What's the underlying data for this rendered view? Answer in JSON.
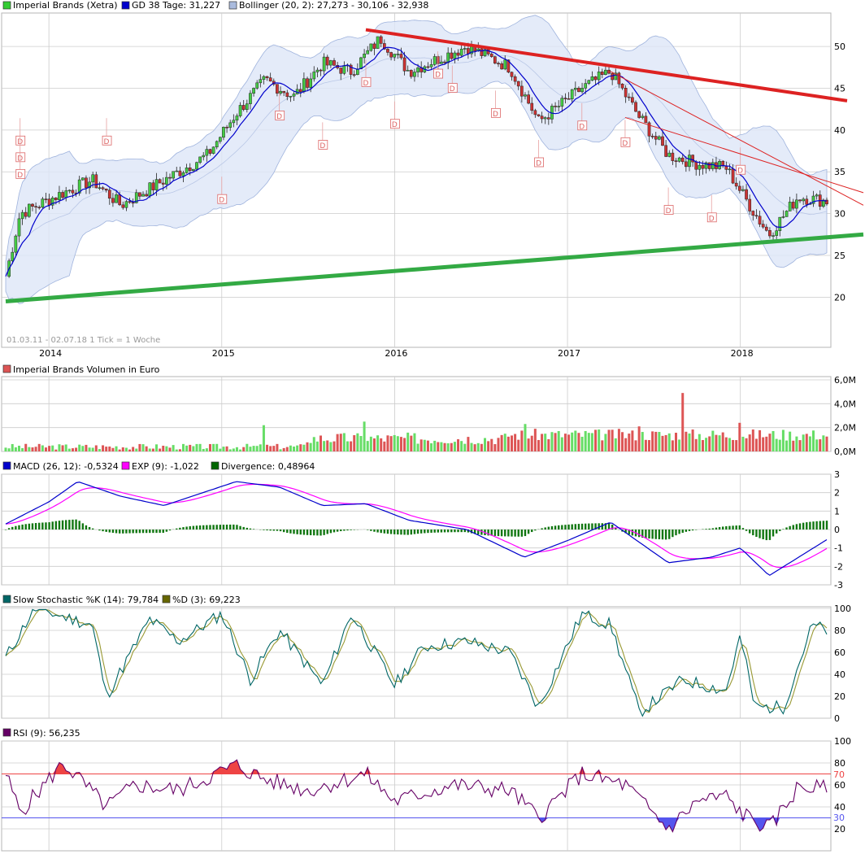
{
  "price_panel": {
    "legend": [
      {
        "label": "Imperial Brands (Xetra)",
        "color": "#33cc33"
      },
      {
        "label": "GD 38 Tage: 31,227",
        "color": "#0000cc"
      },
      {
        "label": "Bollinger (20, 2): 27,273 - 30,106 - 32,938",
        "color": "#aabbdd"
      }
    ],
    "info": "01.03.11 - 02.07.18   1 Tick = 1 Woche",
    "dividend_marker": "D",
    "x_labels": [
      "2014",
      "2015",
      "2016",
      "2017",
      "2018"
    ],
    "y_ticks": [
      20,
      25,
      30,
      35,
      40,
      45,
      50
    ]
  },
  "volume_panel": {
    "legend": [
      {
        "label": "Imperial Brands Volumen in Euro",
        "color": "#dd5555"
      }
    ],
    "y_ticks": [
      "0,0M",
      "2,0M",
      "4,0M",
      "6,0M"
    ]
  },
  "macd_panel": {
    "legend": [
      {
        "label": "MACD (26, 12): -0,5324",
        "color": "#0000cc"
      },
      {
        "label": "EXP (9): -1,022",
        "color": "#ff00ff"
      },
      {
        "label": "Divergence: 0,48964",
        "color": "#006600"
      }
    ],
    "y_ticks": [
      3,
      2,
      1,
      0,
      -1,
      -2,
      -3
    ]
  },
  "stoch_panel": {
    "legend": [
      {
        "label": "Slow Stochastic %K (14): 79,784",
        "color": "#006666"
      },
      {
        "label": "%D (3): 69,223",
        "color": "#666600"
      }
    ],
    "y_ticks": [
      100,
      80,
      60,
      40,
      20,
      0
    ]
  },
  "rsi_panel": {
    "legend": [
      {
        "label": "RSI (9): 56,235",
        "color": "#660066"
      }
    ],
    "y_ticks": [
      100,
      80,
      60,
      40,
      20
    ],
    "upper_label": "70",
    "lower_label": "30"
  },
  "colors": {
    "up": "#44cc44",
    "down": "#cc3333",
    "grid": "#cccccc",
    "trend_down": "#dd2222",
    "trend_up": "#33aa44",
    "band": "#dde6f7",
    "sma": "#0000cc",
    "macd": "#0000cc",
    "signal": "#ff00ff",
    "hist": "#117711",
    "stoch_k": "#006666",
    "stoch_d": "#999933",
    "rsi": "#660066",
    "rsi_hi": "#ee4444",
    "rsi_lo": "#5555ee"
  },
  "chart_data": [
    {
      "type": "candlestick",
      "title": "Imperial Brands (Xetra)",
      "x_range": [
        "2013-10",
        "2018-07"
      ],
      "ylim": [
        14,
        54
      ],
      "close_anchors": [
        {
          "x": "2013-10",
          "y": 22.5
        },
        {
          "x": "2013-11",
          "y": 30
        },
        {
          "x": "2014-02",
          "y": 32.5
        },
        {
          "x": "2014-04",
          "y": 34
        },
        {
          "x": "2014-06",
          "y": 31
        },
        {
          "x": "2014-09",
          "y": 34
        },
        {
          "x": "2014-12",
          "y": 37
        },
        {
          "x": "2015-02",
          "y": 42
        },
        {
          "x": "2015-04",
          "y": 46
        },
        {
          "x": "2015-06",
          "y": 44
        },
        {
          "x": "2015-08",
          "y": 48
        },
        {
          "x": "2015-10",
          "y": 47
        },
        {
          "x": "2015-12",
          "y": 51
        },
        {
          "x": "2016-02",
          "y": 47
        },
        {
          "x": "2016-04",
          "y": 48.5
        },
        {
          "x": "2016-06",
          "y": 50
        },
        {
          "x": "2016-09",
          "y": 47.5
        },
        {
          "x": "2016-11",
          "y": 41
        },
        {
          "x": "2017-02",
          "y": 45
        },
        {
          "x": "2017-04",
          "y": 47
        },
        {
          "x": "2017-06",
          "y": 41.5
        },
        {
          "x": "2017-08",
          "y": 37
        },
        {
          "x": "2017-10",
          "y": 36
        },
        {
          "x": "2017-12",
          "y": 35.5
        },
        {
          "x": "2018-02",
          "y": 30
        },
        {
          "x": "2018-03",
          "y": 27.5
        },
        {
          "x": "2018-05",
          "y": 32
        },
        {
          "x": "2018-07",
          "y": 31.5
        }
      ],
      "dividend_marks": [
        {
          "x": "2013-11",
          "y": 38.5
        },
        {
          "x": "2013-11",
          "y": 36.5
        },
        {
          "x": "2013-11",
          "y": 34.5
        },
        {
          "x": "2014-05",
          "y": 38.5
        },
        {
          "x": "2015-01",
          "y": 31.5
        },
        {
          "x": "2015-05",
          "y": 41.5
        },
        {
          "x": "2015-08",
          "y": 38
        },
        {
          "x": "2015-11",
          "y": 45.5
        },
        {
          "x": "2016-01",
          "y": 40.5
        },
        {
          "x": "2016-04",
          "y": 46.5
        },
        {
          "x": "2016-05",
          "y": 44.8
        },
        {
          "x": "2016-08",
          "y": 41.8
        },
        {
          "x": "2016-11",
          "y": 35.9
        },
        {
          "x": "2017-02",
          "y": 40.3
        },
        {
          "x": "2017-05",
          "y": 38.3
        },
        {
          "x": "2017-08",
          "y": 30.2
        },
        {
          "x": "2017-11",
          "y": 29.3
        },
        {
          "x": "2018-01",
          "y": 35
        }
      ],
      "trendlines": [
        {
          "from": {
            "x": "2015-11",
            "y": 52
          },
          "to": {
            "x": "2018-07",
            "y": 43.5
          }
        },
        {
          "from": {
            "x": "2013-10",
            "y": 19.5
          },
          "to": {
            "x": "2018-07",
            "y": 27.5
          }
        }
      ]
    },
    {
      "type": "bar",
      "title": "Imperial Brands Volumen in Euro",
      "ylim": [
        0,
        6
      ],
      "peaks": [
        {
          "x": "2015-04",
          "y": 2.2
        },
        {
          "x": "2015-11",
          "y": 2.5
        },
        {
          "x": "2016-10",
          "y": 2.3
        },
        {
          "x": "2017-06",
          "y": 2.1
        },
        {
          "x": "2017-09",
          "y": 4.9
        },
        {
          "x": "2018-01",
          "y": 2.4
        }
      ]
    },
    {
      "type": "line",
      "title": "MACD",
      "ylim": [
        -3,
        3
      ],
      "series": [
        {
          "name": "MACD (26, 12)"
        },
        {
          "name": "EXP (9)"
        },
        {
          "name": "Divergence"
        }
      ],
      "macd_anchors": [
        {
          "x": "2013-10",
          "y": 0.3
        },
        {
          "x": "2014-01",
          "y": 1.5
        },
        {
          "x": "2014-03",
          "y": 2.6
        },
        {
          "x": "2014-06",
          "y": 1.8
        },
        {
          "x": "2014-09",
          "y": 1.3
        },
        {
          "x": "2015-02",
          "y": 2.6
        },
        {
          "x": "2015-05",
          "y": 2.3
        },
        {
          "x": "2015-08",
          "y": 1.3
        },
        {
          "x": "2015-11",
          "y": 1.4
        },
        {
          "x": "2016-02",
          "y": 0.5
        },
        {
          "x": "2016-06",
          "y": 0.0
        },
        {
          "x": "2016-10",
          "y": -1.5
        },
        {
          "x": "2017-01",
          "y": -0.6
        },
        {
          "x": "2017-04",
          "y": 0.4
        },
        {
          "x": "2017-08",
          "y": -1.8
        },
        {
          "x": "2017-11",
          "y": -1.5
        },
        {
          "x": "2018-01",
          "y": -1.0
        },
        {
          "x": "2018-03",
          "y": -2.5
        },
        {
          "x": "2018-07",
          "y": -0.55
        }
      ]
    },
    {
      "type": "line",
      "title": "Slow Stochastic",
      "ylim": [
        0,
        100
      ],
      "series": [
        {
          "name": "Slow Stochastic %K (14)"
        },
        {
          "name": "%D (3)"
        }
      ],
      "k_anchors": [
        {
          "x": "2013-10",
          "y": 55
        },
        {
          "x": "2013-12",
          "y": 100
        },
        {
          "x": "2014-04",
          "y": 85
        },
        {
          "x": "2014-05",
          "y": 20
        },
        {
          "x": "2014-08",
          "y": 90
        },
        {
          "x": "2014-10",
          "y": 70
        },
        {
          "x": "2015-01",
          "y": 95
        },
        {
          "x": "2015-03",
          "y": 35
        },
        {
          "x": "2015-05",
          "y": 80
        },
        {
          "x": "2015-08",
          "y": 30
        },
        {
          "x": "2015-10",
          "y": 95
        },
        {
          "x": "2016-01",
          "y": 30
        },
        {
          "x": "2016-03",
          "y": 65
        },
        {
          "x": "2016-06",
          "y": 70
        },
        {
          "x": "2016-09",
          "y": 60
        },
        {
          "x": "2016-11",
          "y": 10
        },
        {
          "x": "2017-02",
          "y": 95
        },
        {
          "x": "2017-04",
          "y": 85
        },
        {
          "x": "2017-06",
          "y": 5
        },
        {
          "x": "2017-09",
          "y": 35
        },
        {
          "x": "2017-12",
          "y": 25
        },
        {
          "x": "2018-01",
          "y": 75
        },
        {
          "x": "2018-02",
          "y": 10
        },
        {
          "x": "2018-04",
          "y": 10
        },
        {
          "x": "2018-06",
          "y": 85
        },
        {
          "x": "2018-07",
          "y": 79.8
        }
      ]
    },
    {
      "type": "line",
      "title": "RSI (9)",
      "ylim": [
        0,
        100
      ],
      "series": [
        {
          "name": "RSI (9)"
        }
      ],
      "reference_lines": [
        70,
        30
      ],
      "rsi_anchors": [
        {
          "x": "2013-10",
          "y": 70
        },
        {
          "x": "2013-11",
          "y": 35
        },
        {
          "x": "2014-02",
          "y": 80
        },
        {
          "x": "2014-05",
          "y": 40
        },
        {
          "x": "2014-07",
          "y": 60
        },
        {
          "x": "2014-10",
          "y": 55
        },
        {
          "x": "2015-02",
          "y": 78
        },
        {
          "x": "2015-04",
          "y": 65
        },
        {
          "x": "2015-07",
          "y": 55
        },
        {
          "x": "2015-11",
          "y": 70
        },
        {
          "x": "2016-01",
          "y": 45
        },
        {
          "x": "2016-05",
          "y": 60
        },
        {
          "x": "2016-09",
          "y": 55
        },
        {
          "x": "2016-11",
          "y": 30
        },
        {
          "x": "2017-02",
          "y": 70
        },
        {
          "x": "2017-05",
          "y": 60
        },
        {
          "x": "2017-08",
          "y": 20
        },
        {
          "x": "2017-10",
          "y": 45
        },
        {
          "x": "2017-12",
          "y": 50
        },
        {
          "x": "2018-01",
          "y": 35
        },
        {
          "x": "2018-03",
          "y": 20
        },
        {
          "x": "2018-05",
          "y": 58
        },
        {
          "x": "2018-07",
          "y": 56.2
        }
      ]
    }
  ]
}
